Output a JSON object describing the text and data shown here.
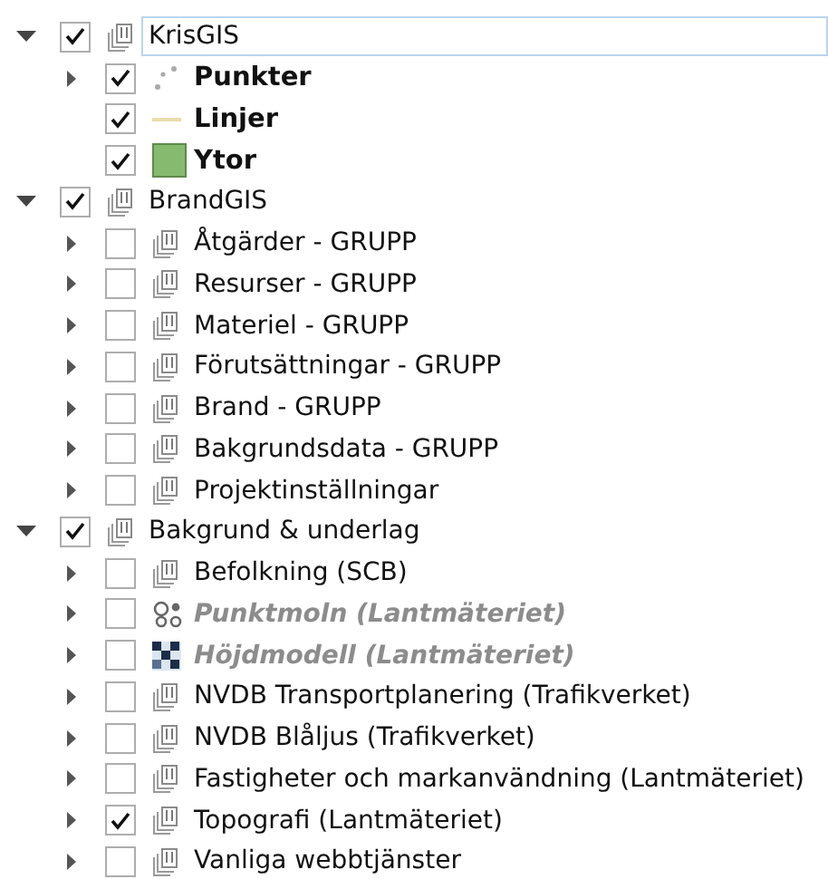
{
  "layer_tree": [
    {
      "label": "KrisGIS",
      "kind": "group",
      "disabled": false,
      "checked": true,
      "expanded": true,
      "selected": true,
      "children": [
        {
          "label": "Punkter",
          "kind": "points",
          "disabled": false,
          "checked": true,
          "expanded": false,
          "selected": false
        },
        {
          "label": "Linjer",
          "kind": "line",
          "disabled": false,
          "checked": true,
          "selected": false
        },
        {
          "label": "Ytor",
          "kind": "polygon",
          "disabled": false,
          "checked": true,
          "selected": false
        }
      ]
    },
    {
      "label": "BrandGIS",
      "kind": "group",
      "disabled": false,
      "checked": true,
      "expanded": true,
      "selected": false,
      "children": [
        {
          "label": "Åtgärder - GRUPP",
          "kind": "group",
          "disabled": false,
          "checked": false,
          "expanded": false,
          "selected": false
        },
        {
          "label": "Resurser - GRUPP",
          "kind": "group",
          "disabled": false,
          "checked": false,
          "expanded": false,
          "selected": false
        },
        {
          "label": "Materiel - GRUPP",
          "kind": "group",
          "disabled": false,
          "checked": false,
          "expanded": false,
          "selected": false
        },
        {
          "label": "Förutsättningar - GRUPP",
          "kind": "group",
          "disabled": false,
          "checked": false,
          "expanded": false,
          "selected": false
        },
        {
          "label": "Brand - GRUPP",
          "kind": "group",
          "disabled": false,
          "checked": false,
          "expanded": false,
          "selected": false
        },
        {
          "label": "Bakgrundsdata - GRUPP",
          "kind": "group",
          "disabled": false,
          "checked": false,
          "expanded": false,
          "selected": false
        },
        {
          "label": "Projektinställningar",
          "kind": "group",
          "disabled": false,
          "checked": false,
          "expanded": false,
          "selected": false
        }
      ]
    },
    {
      "label": "Bakgrund & underlag",
      "kind": "group",
      "disabled": false,
      "checked": true,
      "expanded": true,
      "selected": false,
      "children": [
        {
          "label": "Befolkning (SCB)",
          "kind": "group",
          "disabled": false,
          "checked": false,
          "expanded": false,
          "selected": false
        },
        {
          "label": "Punktmoln (Lantmäteriet)",
          "kind": "pointcloud",
          "disabled": true,
          "checked": false,
          "expanded": false,
          "selected": false
        },
        {
          "label": "Höjdmodell (Lantmäteriet)",
          "kind": "raster",
          "disabled": true,
          "checked": false,
          "expanded": false,
          "selected": false
        },
        {
          "label": "NVDB Transportplanering (Trafikverket)",
          "kind": "group",
          "disabled": false,
          "checked": false,
          "expanded": false,
          "selected": false
        },
        {
          "label": "NVDB Blåljus (Trafikverket)",
          "kind": "group",
          "disabled": false,
          "checked": false,
          "expanded": false,
          "selected": false
        },
        {
          "label": "Fastigheter och markanvändning (Lantmäteriet)",
          "kind": "group",
          "disabled": false,
          "checked": false,
          "expanded": false,
          "selected": false
        },
        {
          "label": "Topografi (Lantmäteriet)",
          "kind": "group",
          "disabled": false,
          "checked": true,
          "expanded": false,
          "selected": false
        },
        {
          "label": "Vanliga webbtjänster",
          "kind": "group",
          "disabled": false,
          "checked": false,
          "expanded": false,
          "selected": false
        }
      ]
    }
  ]
}
